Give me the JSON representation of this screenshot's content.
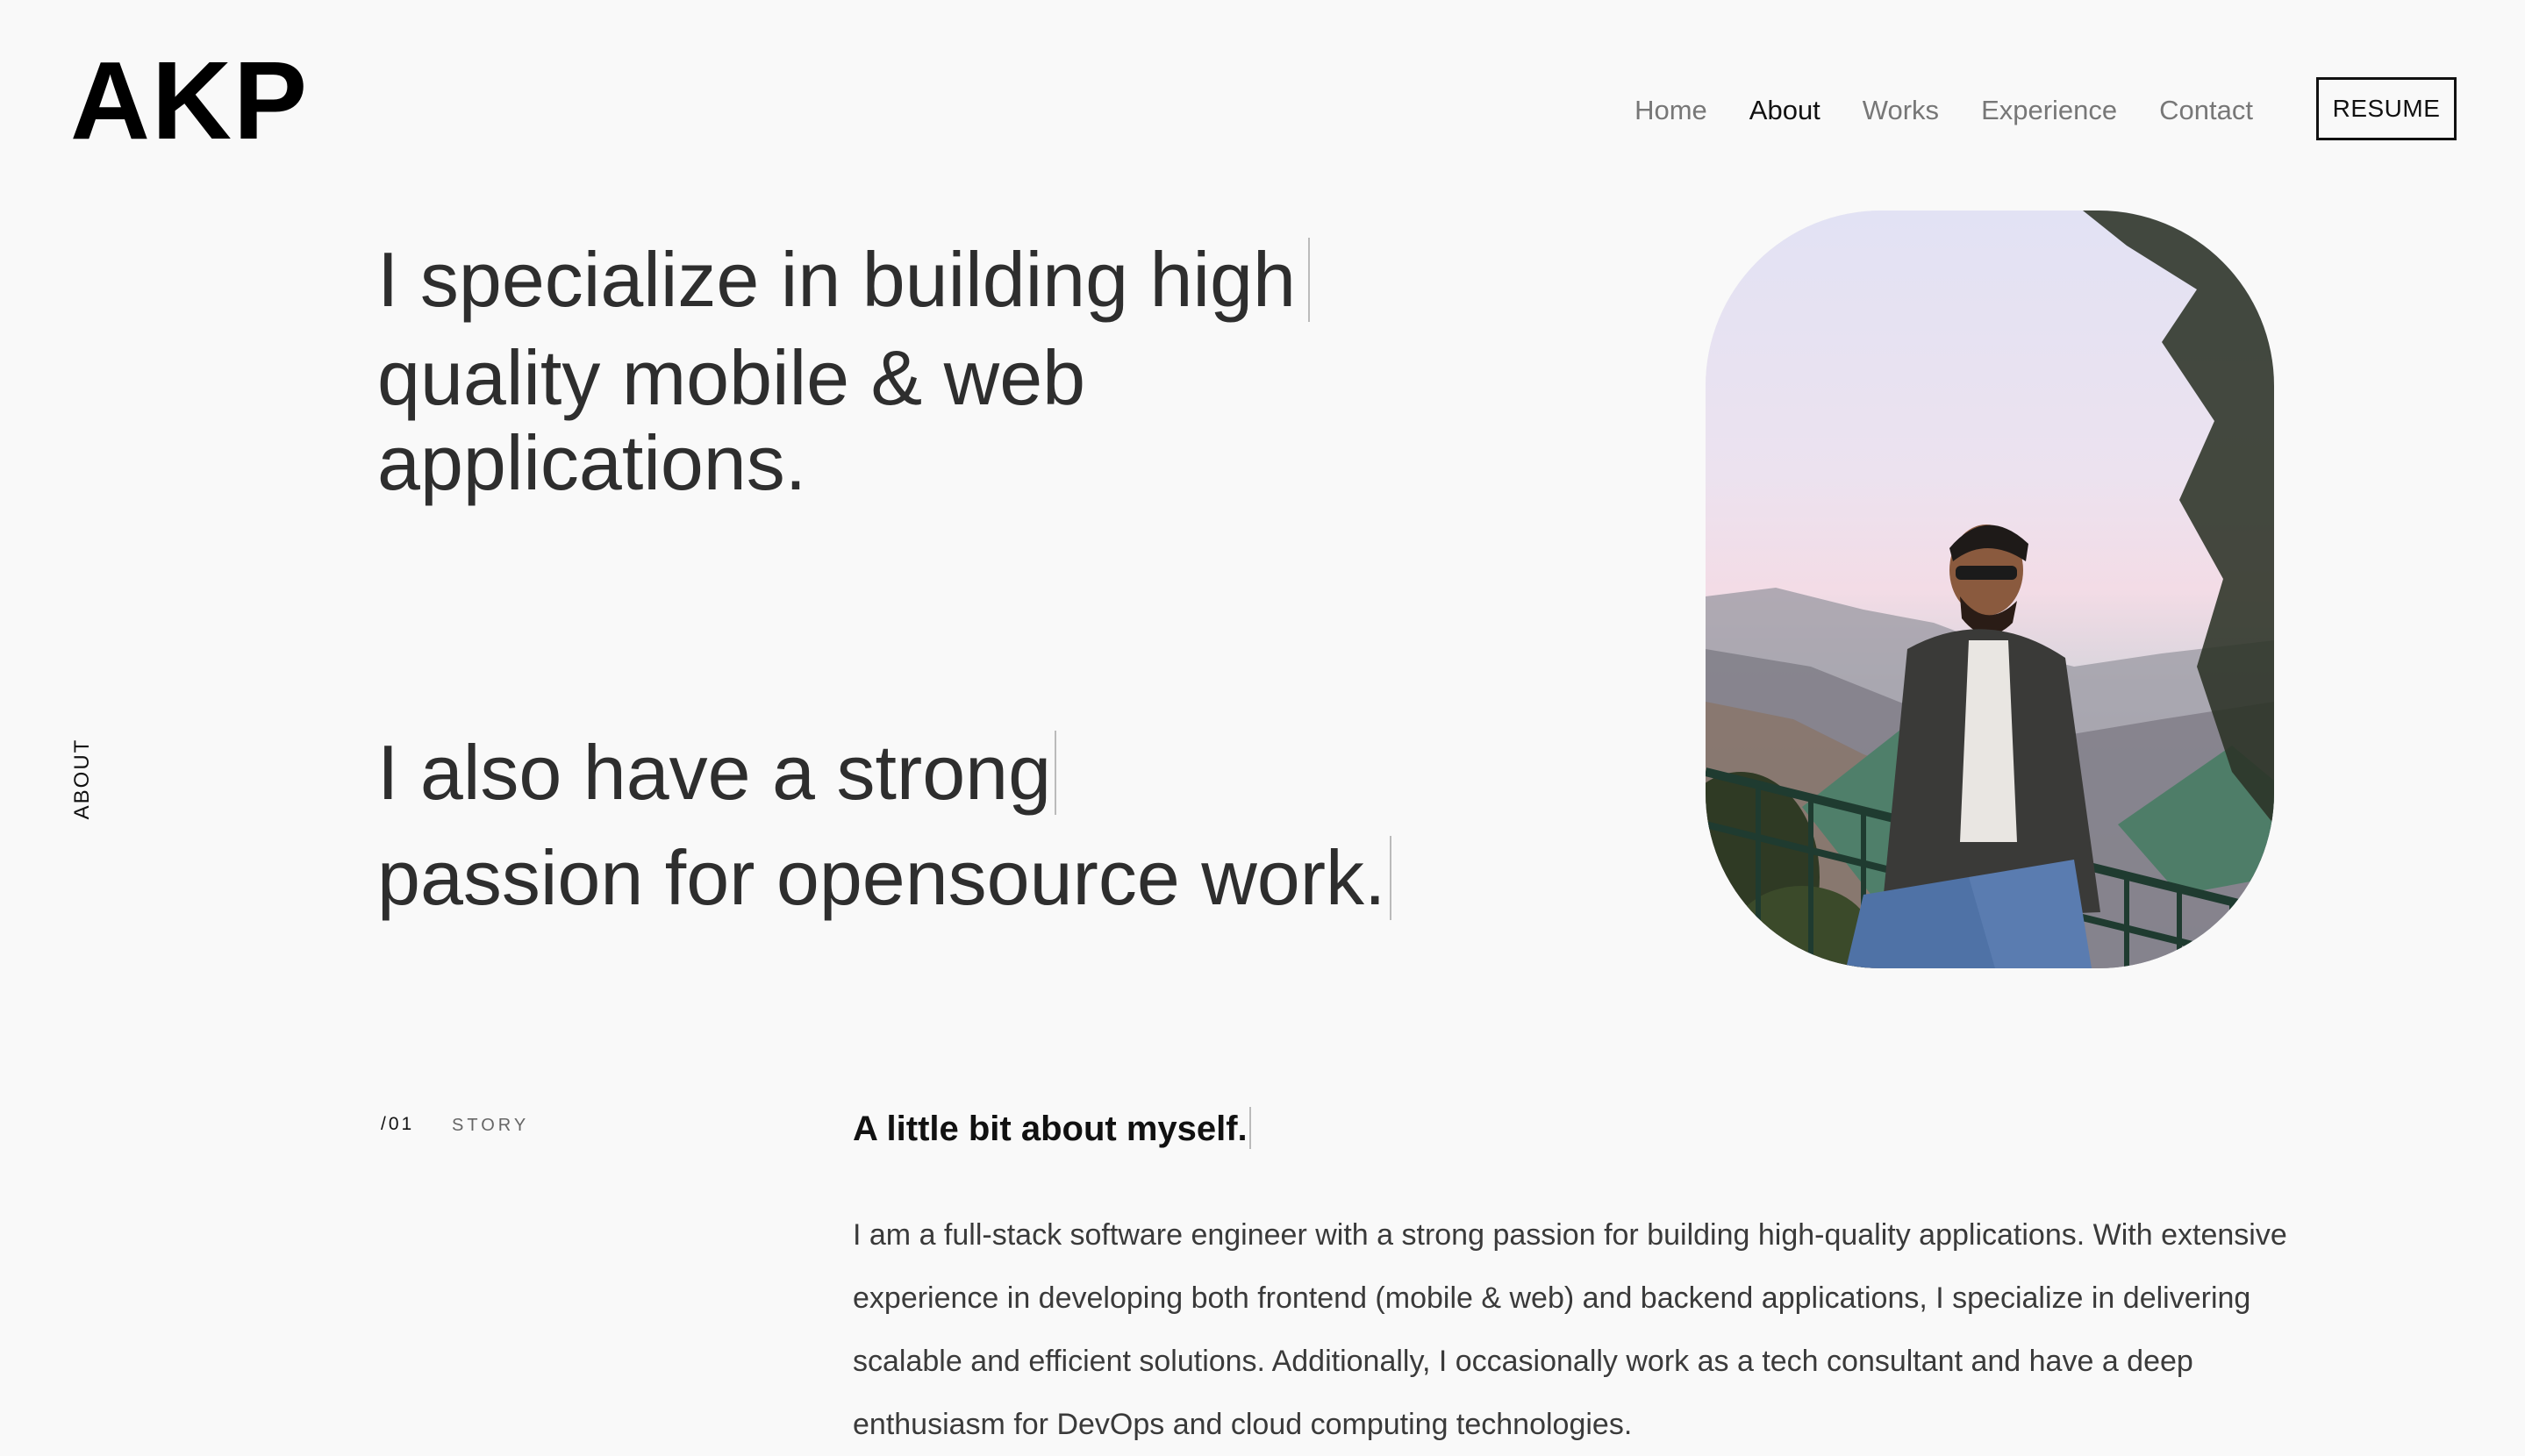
{
  "header": {
    "logo": "AKP",
    "nav": [
      {
        "label": "Home",
        "active": false
      },
      {
        "label": "About",
        "active": true
      },
      {
        "label": "Works",
        "active": false
      },
      {
        "label": "Experience",
        "active": false
      },
      {
        "label": "Contact",
        "active": false
      }
    ],
    "resume_label": "RESUME"
  },
  "side_label": "ABOUT",
  "hero": {
    "block1": [
      "I specialize in building high",
      "quality mobile & web",
      "applications."
    ],
    "block2": [
      "I also have a strong",
      "passion for opensource work."
    ]
  },
  "story": {
    "index": "/01",
    "label": "STORY",
    "title": "A little bit about myself.",
    "body": "I am a full-stack software engineer with a strong passion for building high-quality applications. With extensive experience in developing both frontend (mobile & web) and backend applications, I specialize in delivering scalable and efficient solutions. Additionally, I occasionally work as a tech consultant and have a deep enthusiasm for DevOps and cloud computing technologies."
  },
  "colors": {
    "background": "#f9f9f9",
    "text": "#111111",
    "muted": "#777777"
  }
}
